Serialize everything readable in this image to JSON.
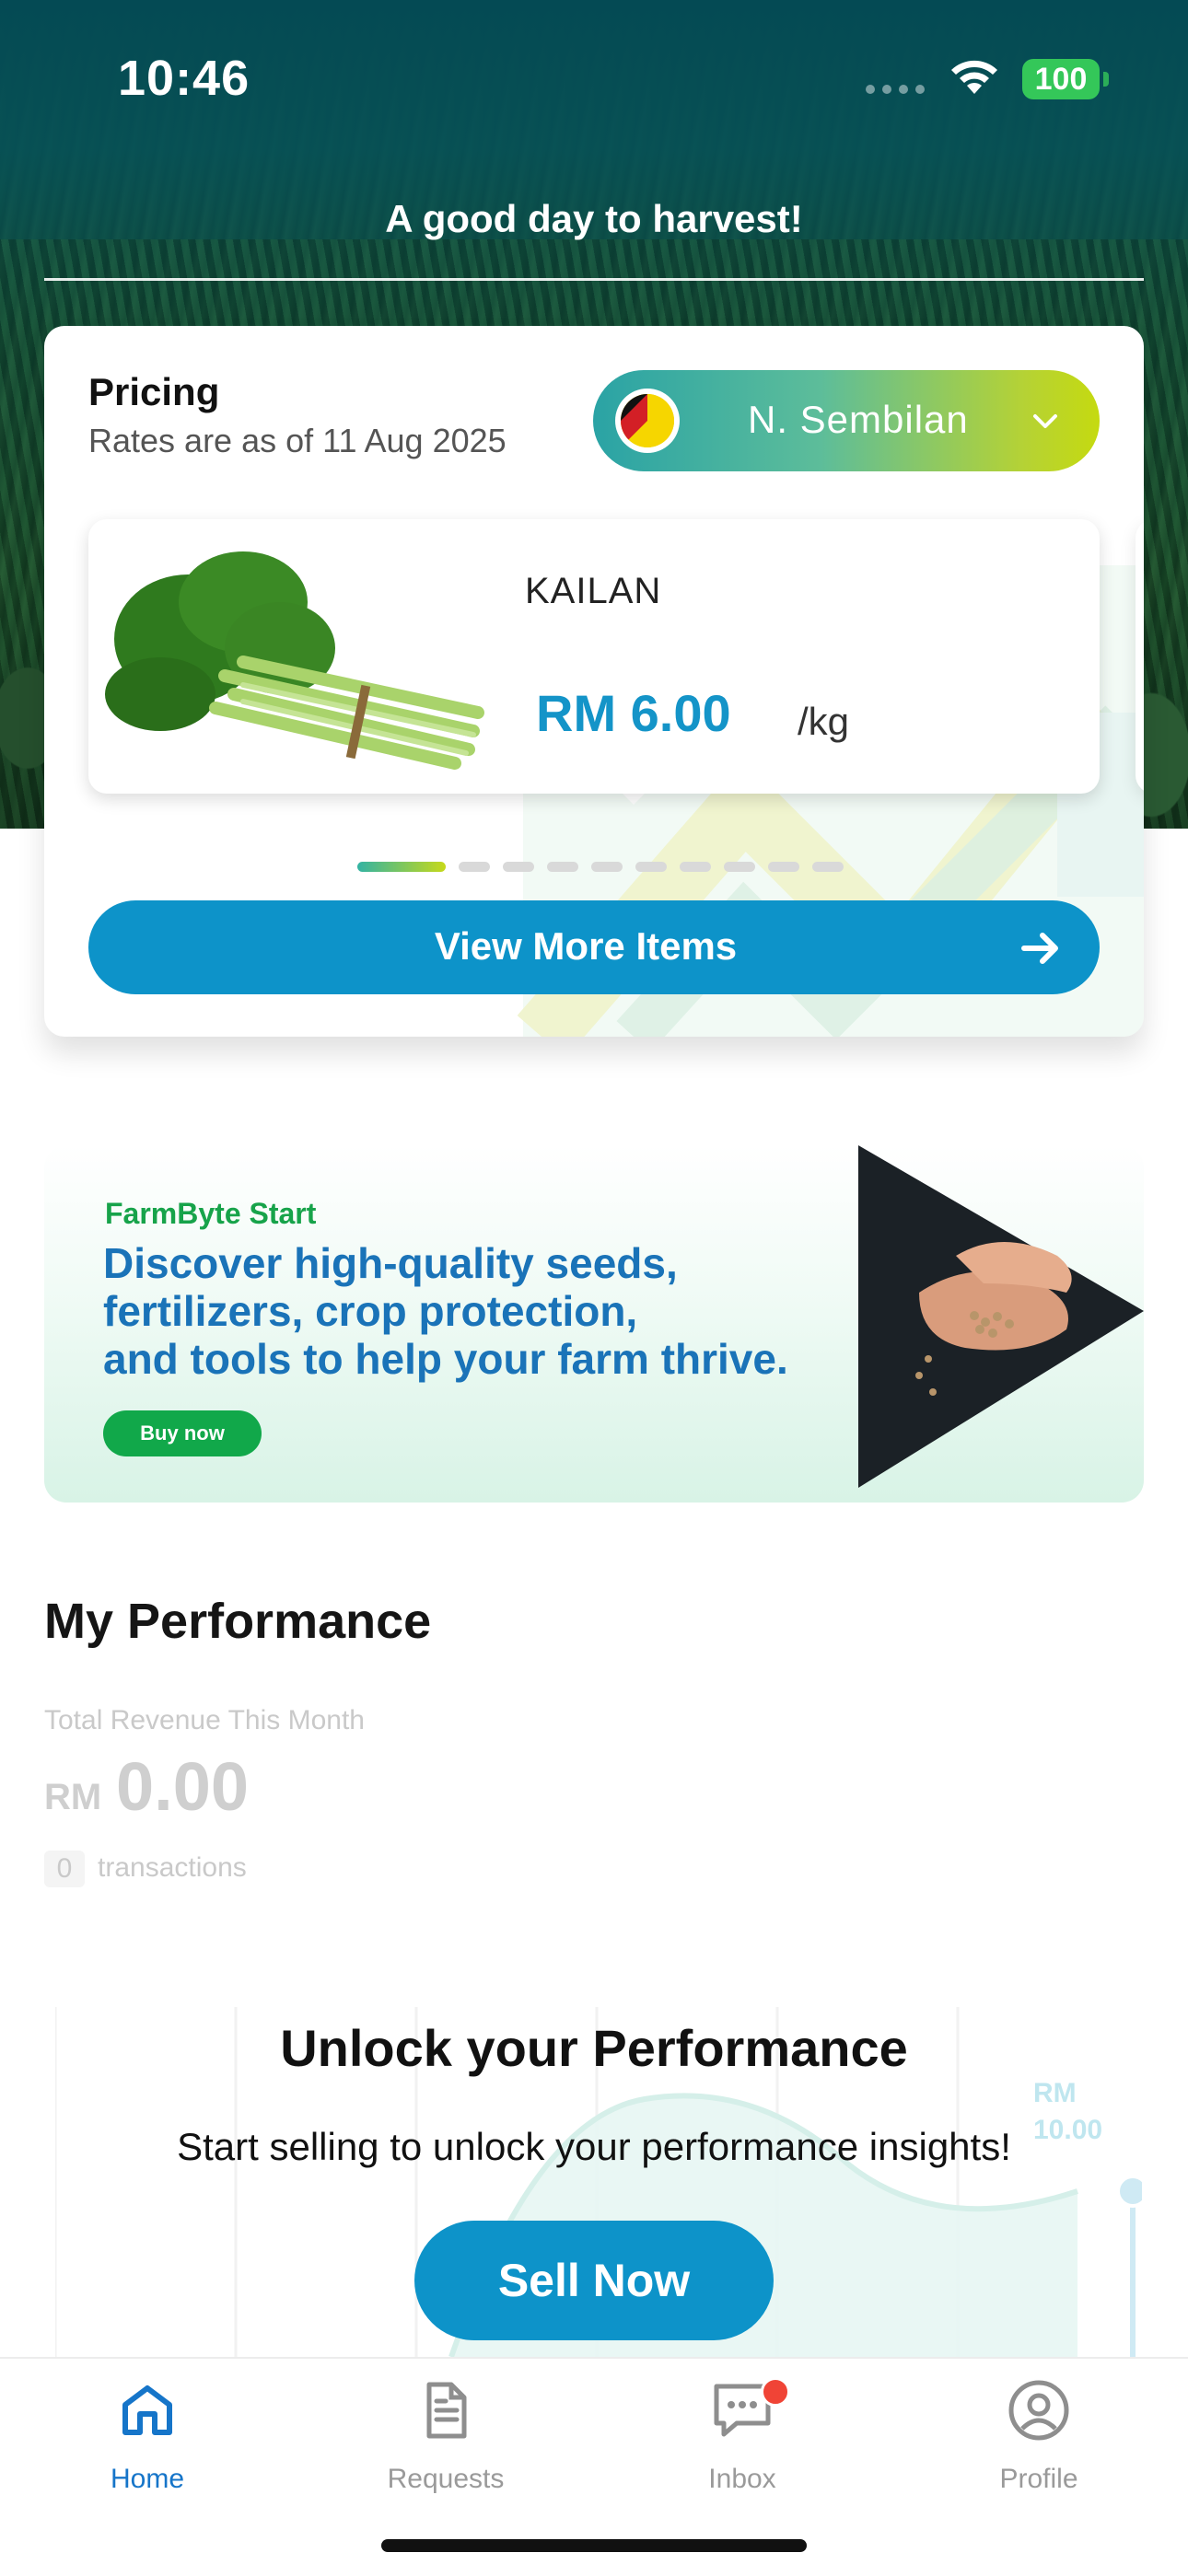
{
  "status_bar": {
    "time": "10:46",
    "battery": "100"
  },
  "header": {
    "greeting": "A good day to harvest!"
  },
  "pricing": {
    "title": "Pricing",
    "subtitle": "Rates are as of 11 Aug 2025",
    "state": "N. Sembilan",
    "item": {
      "name": "KAILAN",
      "price": "RM 6.00",
      "unit": "/kg"
    },
    "pager": {
      "pages": 11,
      "current": 1
    },
    "view_more_label": "View More Items"
  },
  "banner": {
    "brand": "FarmByte Start",
    "headline_line1": "Discover high-quality seeds,",
    "headline_line2": "fertilizers, crop protection,",
    "headline_line3": "and tools to help your farm thrive.",
    "cta": "Buy now"
  },
  "performance": {
    "title": "My Performance",
    "revenue_label": "Total Revenue This Month",
    "currency": "RM",
    "revenue_amount": "0.00",
    "transaction_count": "0",
    "transactions_label": "transactions",
    "chart_rm_label": "RM",
    "chart_rm_value": "10.00",
    "unlock_title": "Unlock your Performance",
    "unlock_subtitle": "Start selling to unlock your performance insights!",
    "sell_label": "Sell Now"
  },
  "tabbar": {
    "items": [
      {
        "label": "Home",
        "icon": "home-icon",
        "active": true
      },
      {
        "label": "Requests",
        "icon": "document-icon",
        "active": false
      },
      {
        "label": "Inbox",
        "icon": "chat-icon",
        "active": false,
        "badge": true
      },
      {
        "label": "Profile",
        "icon": "user-circle-icon",
        "active": false
      }
    ]
  },
  "colors": {
    "primary": "#0d93c9",
    "active_tab": "#1675c9",
    "banner_green": "#11a84a",
    "header_teal": "#044a54"
  }
}
